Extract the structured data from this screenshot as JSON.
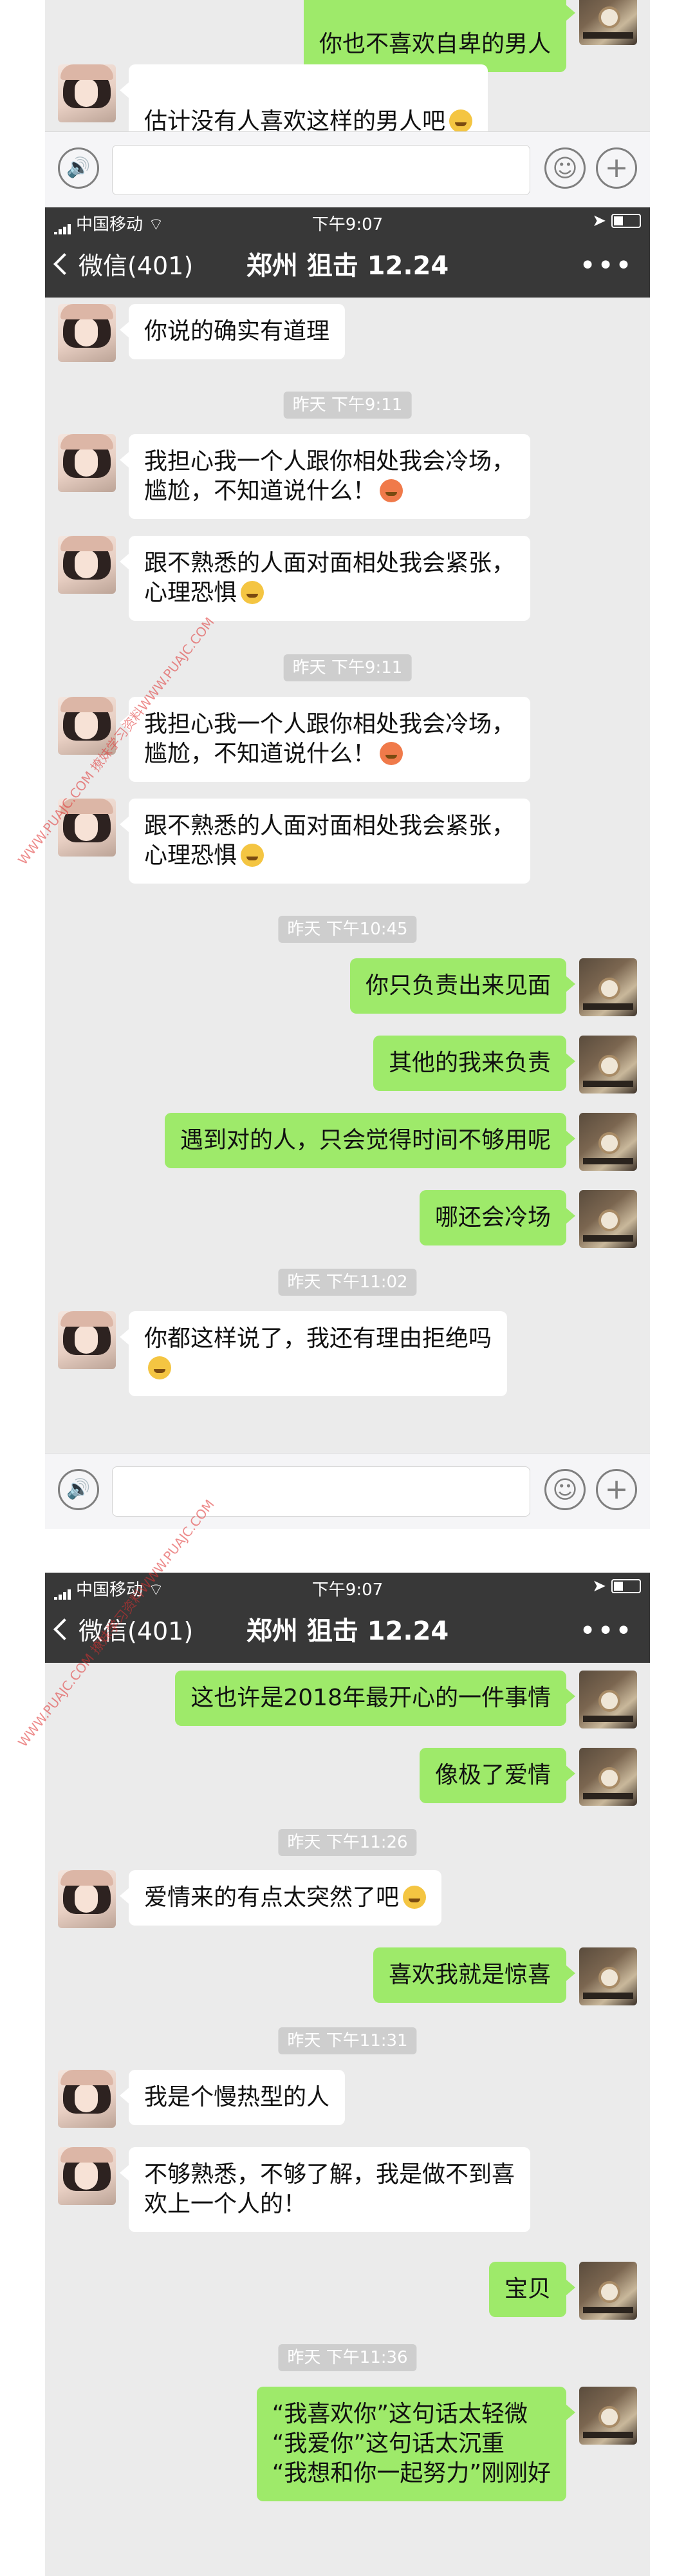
{
  "status_bar": {
    "carrier": "中国移动",
    "time": "下午9:07"
  },
  "nav": {
    "back_label": "微信(401)",
    "title": "郑州 狙击 12.24",
    "more": "•••"
  },
  "input_bar": {
    "voice": "🔊",
    "emoji": "☺",
    "plus": "+"
  },
  "screen1": {
    "messages": [
      {
        "text": "你也不喜欢自卑的男人"
      },
      {
        "text": "估计没有人喜欢这样的男人吧"
      }
    ]
  },
  "screen2": {
    "messages": [
      {
        "text": "你说的确实有道理"
      },
      {
        "text": "我担心我一个人跟你相处我会冷场，\n尴尬，不知道说什么！"
      },
      {
        "text": "跟不熟悉的人面对面相处我会紧张，\n心理恐惧"
      },
      {
        "text": "我担心我一个人跟你相处我会冷场，\n尴尬，不知道说什么！"
      },
      {
        "text": "跟不熟悉的人面对面相处我会紧张，\n心理恐惧"
      },
      {
        "text": "你只负责出来见面"
      },
      {
        "text": "其他的我来负责"
      },
      {
        "text": "遇到对的人，只会觉得时间不够用呢"
      },
      {
        "text": "哪还会冷场"
      },
      {
        "text": "你都这样说了，我还有理由拒绝吗"
      }
    ],
    "timestamps": [
      "昨天 下午9:11",
      "昨天 下午9:11",
      "昨天 下午10:45",
      "昨天 下午11:02"
    ]
  },
  "screen3": {
    "messages": [
      {
        "text": "这也许是2018年最开心的一件事情"
      },
      {
        "text": "像极了爱情"
      },
      {
        "text": "爱情来的有点太突然了吧"
      },
      {
        "text": "喜欢我就是惊喜"
      },
      {
        "text": "我是个慢热型的人"
      },
      {
        "text": "不够熟悉，不够了解，我是做不到喜\n欢上一个人的！"
      },
      {
        "text": "宝贝"
      },
      {
        "text": "“我喜欢你”这句话太轻微\n“我爱你”这句话太沉重\n“我想和你一起努力”刚刚好"
      }
    ],
    "timestamps": [
      "昨天 下午11:26",
      "昨天 下午11:31",
      "昨天 下午11:36"
    ]
  },
  "watermark": "WWW.PUAJC.COM 撩妹学习资料WWW.PUAJC.COM"
}
